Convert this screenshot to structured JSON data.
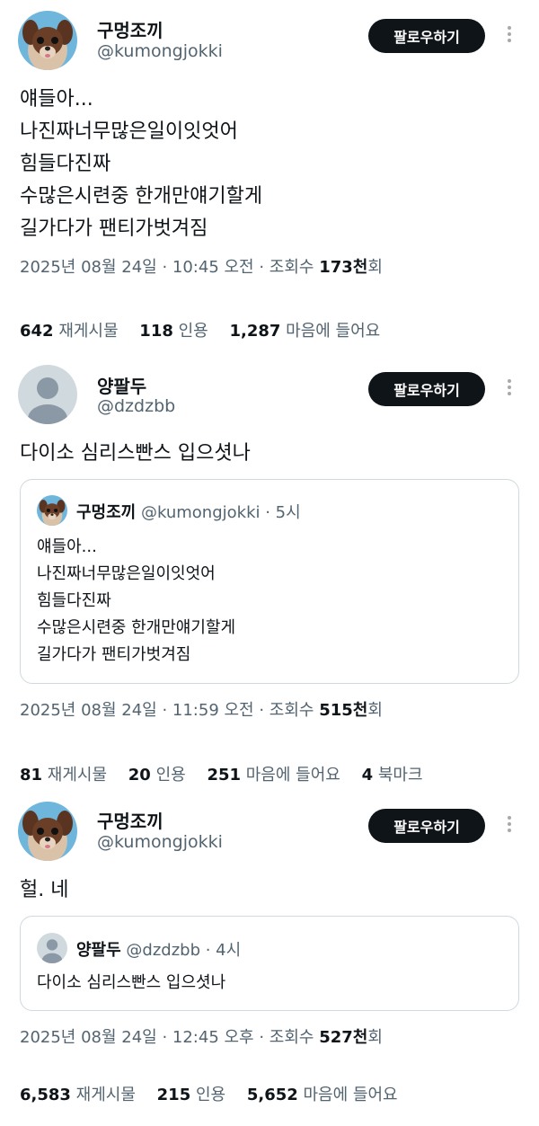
{
  "tweets": [
    {
      "name": "구멍조끼",
      "handle": "@kumongjokki",
      "follow_label": "팔로우하기",
      "text": [
        "얘들아...",
        "나진짜너무많은일이잇엇어",
        "힘들다진짜",
        "수많은시련중 한개만얘기할게",
        "길가다가 팬티가벗겨짐"
      ],
      "meta_prefix": "2025년 08월 24일 · 10:45 오전 · 조회수 ",
      "meta_views": "173천",
      "meta_suffix": "회",
      "stats": [
        {
          "count": "642",
          "label": "재게시물"
        },
        {
          "count": "118",
          "label": "인용"
        },
        {
          "count": "1,287",
          "label": "마음에 들어요"
        }
      ]
    },
    {
      "name": "양팔두",
      "handle": "@dzdzbb",
      "follow_label": "팔로우하기",
      "text": [
        "다이소 심리스빤스 입으셧나"
      ],
      "quote": {
        "name": "구멍조끼",
        "handle_time": "@kumongjokki · 5시",
        "text": [
          "얘들아...",
          "나진짜너무많은일이잇엇어",
          "힘들다진짜",
          "수많은시련중 한개만얘기할게",
          "길가다가 팬티가벗겨짐"
        ]
      },
      "meta_prefix": "2025년 08월 24일 · 11:59 오전 · 조회수 ",
      "meta_views": "515천",
      "meta_suffix": "회",
      "stats": [
        {
          "count": "81",
          "label": "재게시물"
        },
        {
          "count": "20",
          "label": "인용"
        },
        {
          "count": "251",
          "label": "마음에 들어요"
        },
        {
          "count": "4",
          "label": "북마크"
        }
      ]
    },
    {
      "name": "구멍조끼",
      "handle": "@kumongjokki",
      "follow_label": "팔로우하기",
      "text": [
        "헐. 네"
      ],
      "quote": {
        "name": "양팔두",
        "handle_time": "@dzdzbb · 4시",
        "text": [
          "다이소 심리스빤스 입으셧나"
        ]
      },
      "meta_prefix": "2025년 08월 24일 · 12:45 오후 · 조회수 ",
      "meta_views": "527천",
      "meta_suffix": "회",
      "stats": [
        {
          "count": "6,583",
          "label": "재게시물"
        },
        {
          "count": "215",
          "label": "인용"
        },
        {
          "count": "5,652",
          "label": "마음에 들어요"
        }
      ]
    }
  ],
  "icons": {
    "dog_avatar": "dog-avatar-icon",
    "default_avatar": "default-avatar-icon",
    "more": "more-options-icon"
  }
}
